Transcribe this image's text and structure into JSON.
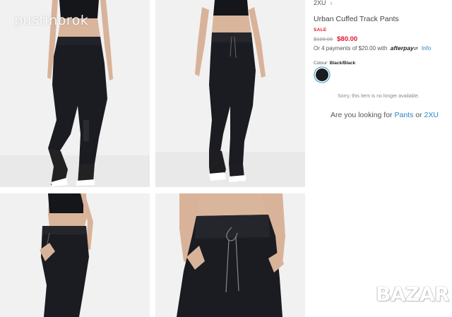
{
  "watermarks": {
    "top_left": "pustinorok",
    "bottom_right": "BAZAR"
  },
  "product": {
    "brand": "2XU",
    "brand_chevron": "›",
    "title": "Urban Cuffed Track Pants",
    "sale_badge": "SALE",
    "price_was": "$120.00",
    "price_now": "$80.00",
    "installments_text": "Or 4 payments of $20.00 with",
    "afterpay_label": "afterpay",
    "info_link": "Info",
    "colour_label": "Colour:",
    "colour_value": "Black/Black",
    "swatch_color": "#1a1c22",
    "unavailable_text": "Sorry, this item is no longer available.",
    "looking_prefix": "Are you looking for",
    "looking_link_1": "Pants",
    "looking_or": "or",
    "looking_link_2": "2XU"
  },
  "colors": {
    "sale_red": "#e0182d",
    "link_blue": "#2a84c4",
    "photo_bg": "#f1f1f1"
  },
  "gallery": {
    "images": [
      "back-view-photo",
      "front-view-photo",
      "side-view-photo",
      "waist-closeup-photo"
    ]
  }
}
